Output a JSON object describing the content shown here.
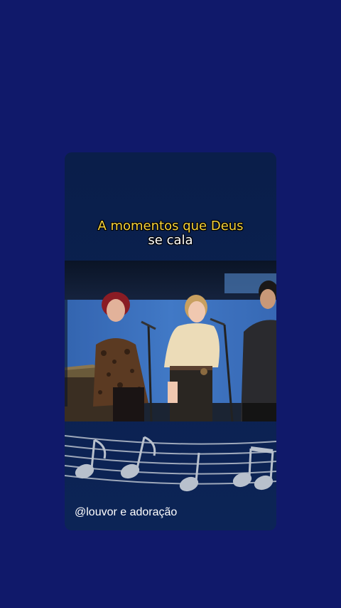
{
  "caption": {
    "line1": "A momentos que Deus",
    "line2": "se cala"
  },
  "handle": "@louvor e adoração",
  "colors": {
    "background": "#10196a",
    "card": "#0b2150",
    "caption_highlight": "#f7d23a"
  },
  "icons": [
    "music-notes-icon"
  ]
}
